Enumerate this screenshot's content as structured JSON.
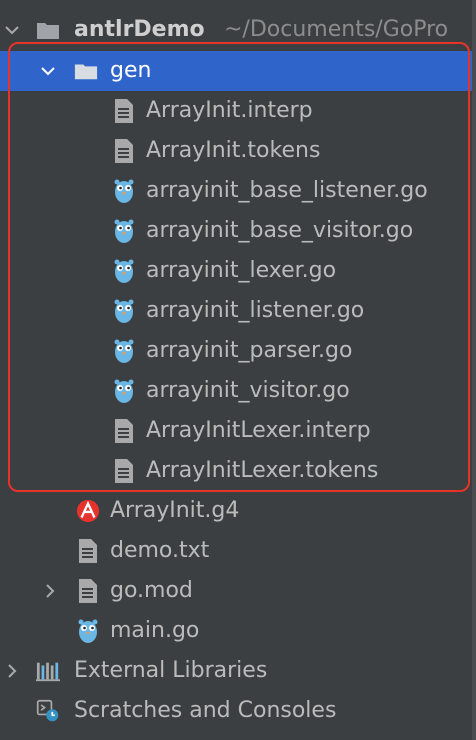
{
  "project": {
    "name": "antlrDemo",
    "path": "~/Documents/GoPro"
  },
  "gen_folder": {
    "label": "gen",
    "files": [
      {
        "label": "ArrayInit.interp",
        "icon": "text-file-icon"
      },
      {
        "label": "ArrayInit.tokens",
        "icon": "text-file-icon"
      },
      {
        "label": "arrayinit_base_listener.go",
        "icon": "gopher-icon"
      },
      {
        "label": "arrayinit_base_visitor.go",
        "icon": "gopher-icon"
      },
      {
        "label": "arrayinit_lexer.go",
        "icon": "gopher-icon"
      },
      {
        "label": "arrayinit_listener.go",
        "icon": "gopher-icon"
      },
      {
        "label": "arrayinit_parser.go",
        "icon": "gopher-icon"
      },
      {
        "label": "arrayinit_visitor.go",
        "icon": "gopher-icon"
      },
      {
        "label": "ArrayInitLexer.interp",
        "icon": "text-file-icon"
      },
      {
        "label": "ArrayInitLexer.tokens",
        "icon": "text-file-icon"
      }
    ]
  },
  "project_files": [
    {
      "label": "ArrayInit.g4",
      "icon": "antlr-icon"
    },
    {
      "label": "demo.txt",
      "icon": "text-file-icon"
    },
    {
      "label": "go.mod",
      "icon": "text-file-icon"
    },
    {
      "label": "main.go",
      "icon": "gopher-icon"
    }
  ],
  "external_libraries": {
    "label": "External Libraries"
  },
  "scratches": {
    "label": "Scratches and Consoles"
  },
  "colors": {
    "background": "#3c3f41",
    "selection": "#2f65ca",
    "highlight_border": "#e6332a",
    "gopher": "#6ab7e6",
    "antlr": "#e5322d"
  }
}
